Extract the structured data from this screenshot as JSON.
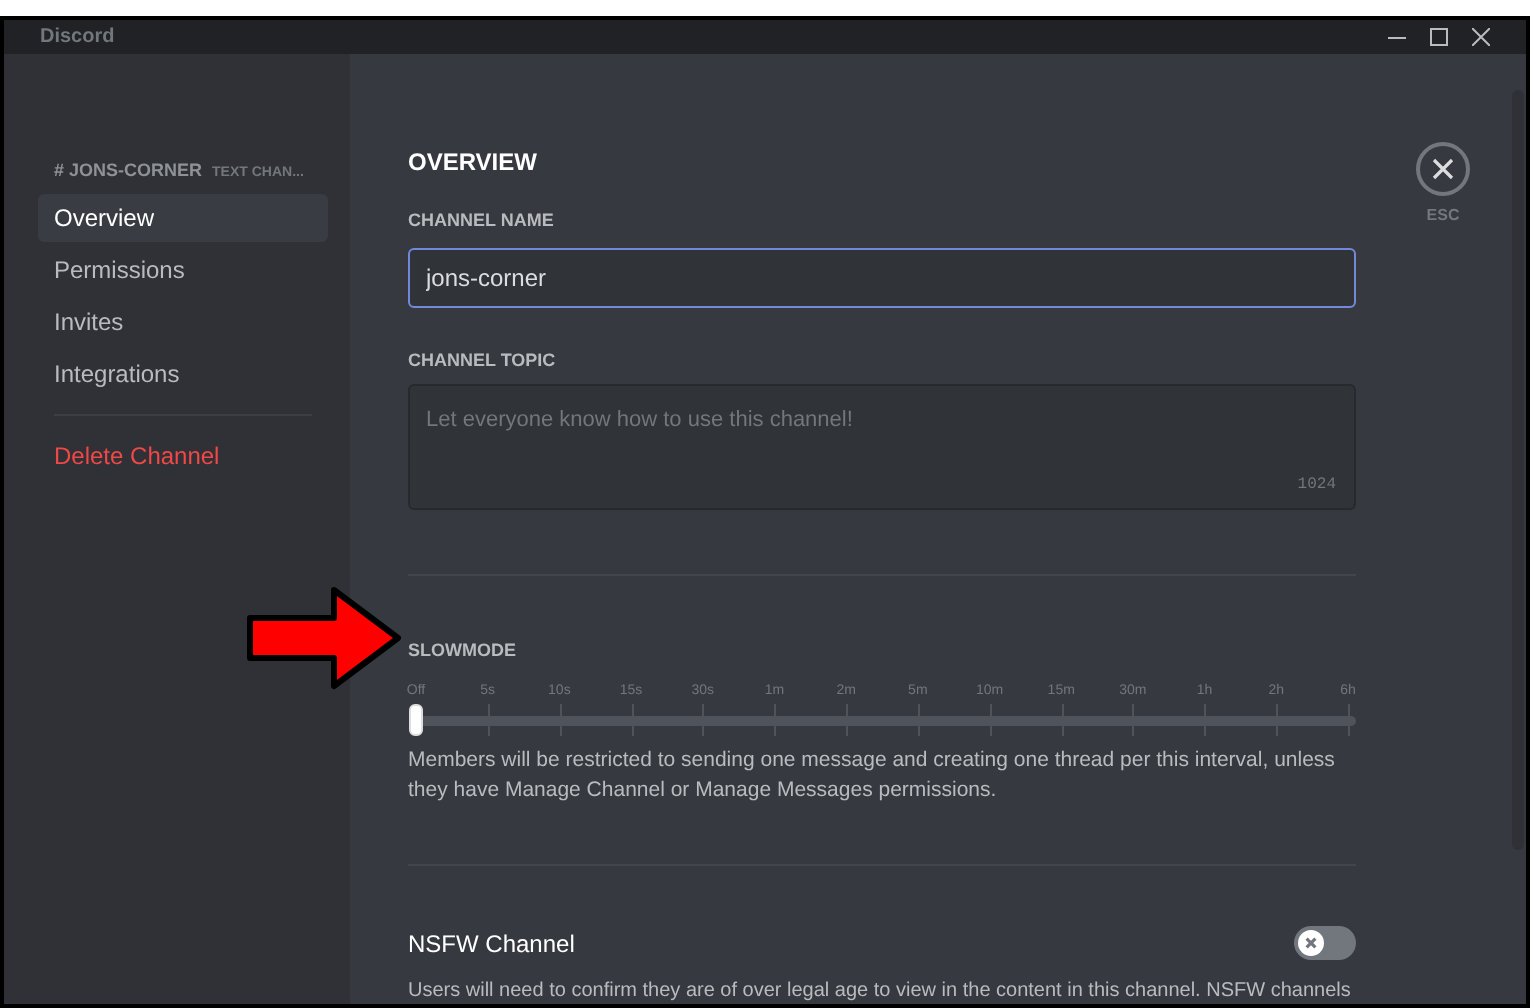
{
  "window": {
    "title": "Discord"
  },
  "sidebar": {
    "header": {
      "channel": "# JONS-CORNER",
      "kind_label": "TEXT CHAN..."
    },
    "items": [
      {
        "label": "Overview",
        "selected": true
      },
      {
        "label": "Permissions",
        "selected": false
      },
      {
        "label": "Invites",
        "selected": false
      },
      {
        "label": "Integrations",
        "selected": false
      }
    ],
    "danger_item": {
      "label": "Delete Channel"
    }
  },
  "close": {
    "label": "ESC"
  },
  "overview": {
    "title": "OVERVIEW",
    "channel_name": {
      "label": "CHANNEL NAME",
      "value": "jons-corner"
    },
    "channel_topic": {
      "label": "CHANNEL TOPIC",
      "placeholder": "Let everyone know how to use this channel!",
      "counter": "1024"
    }
  },
  "slowmode": {
    "label": "SLOWMODE",
    "ticks": [
      "Off",
      "5s",
      "10s",
      "15s",
      "30s",
      "1m",
      "2m",
      "5m",
      "10m",
      "15m",
      "30m",
      "1h",
      "2h",
      "6h"
    ],
    "level": 0,
    "description": "Members will be restricted to sending one message and creating one thread per this interval, unless they have Manage Channel or Manage Messages permissions."
  },
  "nsfw": {
    "title": "NSFW Channel",
    "on": false,
    "description": "Users will need to confirm they are of over legal age to view in the content in this channel. NSFW channels"
  }
}
